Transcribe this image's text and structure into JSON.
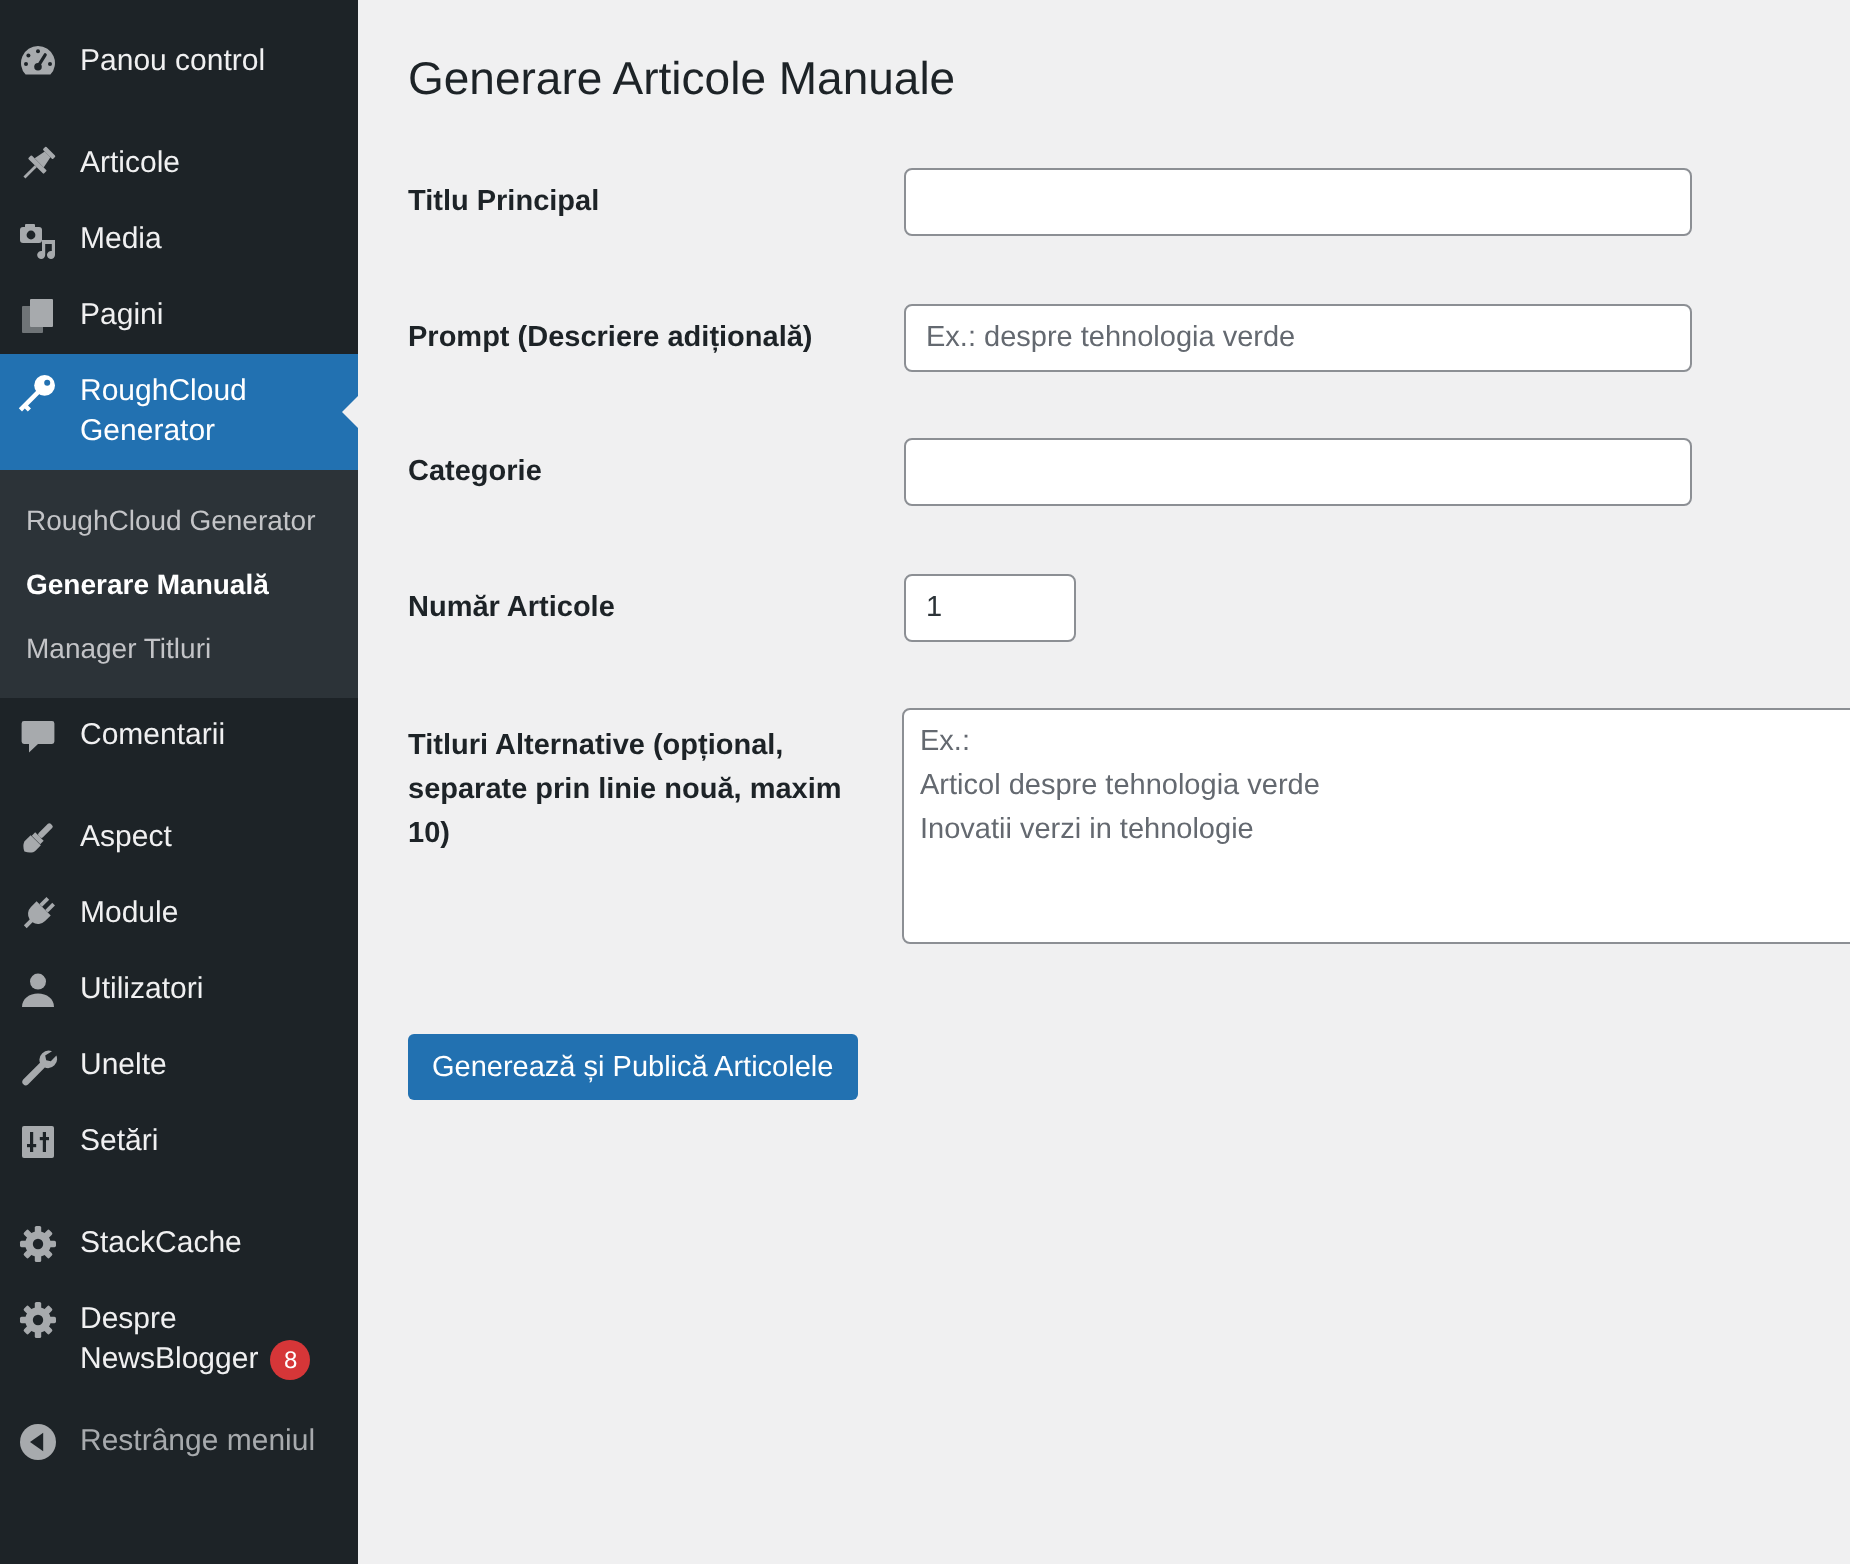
{
  "sidebar": {
    "groups": [
      [
        {
          "label": "Panou control",
          "selected": false
        }
      ],
      [
        {
          "label": "Articole",
          "selected": false
        },
        {
          "label": "Media",
          "selected": false
        },
        {
          "label": "Pagini",
          "selected": false
        },
        {
          "label": "RoughCloud Generator",
          "selected": true,
          "children": [
            {
              "label": "RoughCloud Generator",
              "selected": false
            },
            {
              "label": "Generare Manuală",
              "selected": true
            },
            {
              "label": "Manager Titluri",
              "selected": false
            }
          ]
        },
        {
          "label": "Comentarii",
          "selected": false
        }
      ],
      [
        {
          "label": "Aspect",
          "selected": false
        },
        {
          "label": "Module",
          "selected": false
        },
        {
          "label": "Utilizatori",
          "selected": false
        },
        {
          "label": "Unelte",
          "selected": false
        },
        {
          "label": "Setări",
          "selected": false
        }
      ],
      [
        {
          "label": "StackCache",
          "selected": false
        },
        {
          "label": "Despre NewsBlogger",
          "selected": false,
          "badge": "8"
        }
      ]
    ],
    "collapse_label": "Restrânge meniul"
  },
  "page": {
    "title": "Generare Articole Manuale",
    "fields": [
      {
        "label": "Titlu Principal",
        "kind": "text"
      },
      {
        "label": "Prompt (Descriere adițională)",
        "kind": "text",
        "placeholder": "Ex.: despre tehnologia verde"
      },
      {
        "label": "Categorie",
        "kind": "text"
      },
      {
        "label": "Număr Articole",
        "kind": "number",
        "value": "1"
      },
      {
        "label": "Titluri Alternative (opțional, separate prin linie nouă, maxim 10)",
        "kind": "textarea",
        "placeholder": "Ex.:\nArticol despre tehnologia verde\nInovatii verzi in tehnologie"
      }
    ],
    "submit_label": "Generează și Publică Articolele"
  }
}
